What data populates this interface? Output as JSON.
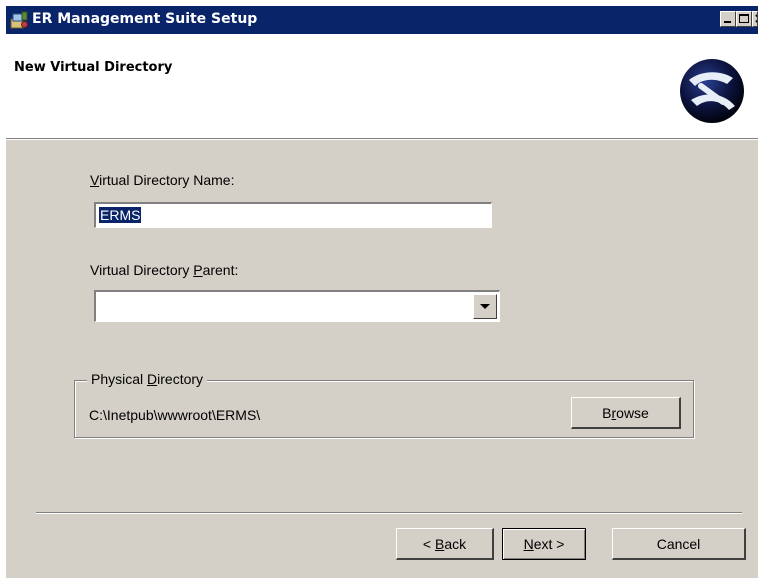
{
  "window": {
    "title": "ER Management Suite Setup",
    "controls": [
      "minimize-icon",
      "maximize-icon",
      "close-icon"
    ]
  },
  "header": {
    "title": "New Virtual Directory",
    "logo": "setup-logo"
  },
  "form": {
    "vdir_name": {
      "label_pre": "",
      "label_key": "V",
      "label_post": "irtual Directory Name:",
      "value": "ERMS"
    },
    "vdir_parent": {
      "label_pre": "Virtual Directory ",
      "label_key": "P",
      "label_post": "arent:",
      "value": ""
    },
    "physical": {
      "legend_pre": "Physical ",
      "legend_key": "D",
      "legend_post": "irectory",
      "path": "C:\\Inetpub\\wwwroot\\ERMS\\",
      "browse_pre": "B",
      "browse_key": "r",
      "browse_post": "owse"
    }
  },
  "footer": {
    "back_pre": "< ",
    "back_key": "B",
    "back_post": "ack",
    "next_key": "N",
    "next_post": "ext >",
    "cancel": "Cancel"
  },
  "colors": {
    "titlebar": "#0a246a",
    "dialog_bg": "#d4d0c8",
    "header_bg": "#ffffff",
    "selection": "#0a246a"
  }
}
